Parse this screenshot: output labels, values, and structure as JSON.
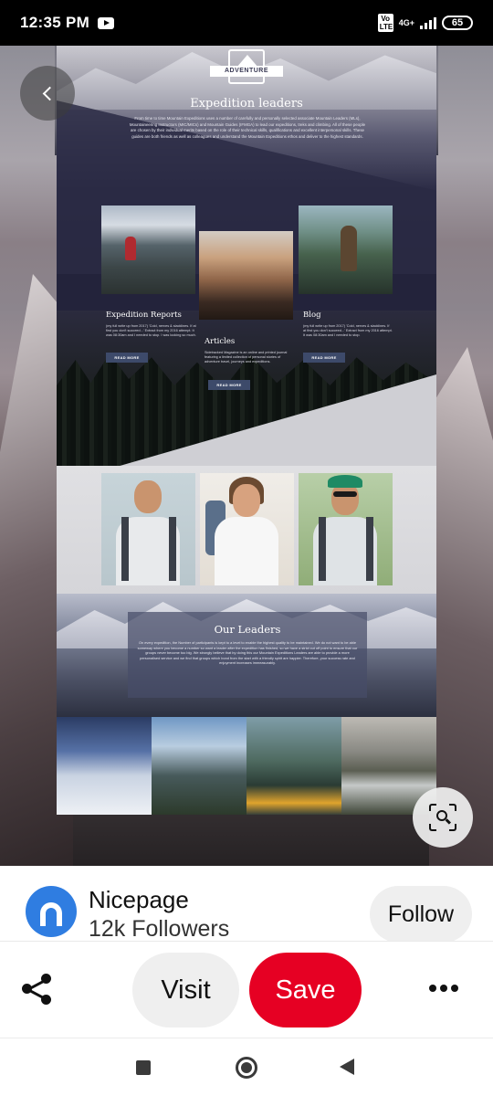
{
  "status_bar": {
    "time": "12:35 PM",
    "volte": "Vo LTE",
    "network": "4G+",
    "battery": "65"
  },
  "pin": {
    "page": {
      "logo_text": "ADVENTURE",
      "hero_title": "Expedition leaders",
      "hero_text": "From time to time Mountain Expeditions uses a number of carefully and personally selected associate Mountain Leaders (MLs), Mountaineering Instructors (MIC/MICs) and Mountain Guides (IFMGA) to lead our expeditions, treks and climbing. All of these people are chosen by their individual merits based on the role of their technical skills, qualifications and excellent interpersonal skills. These guides are both friends as well as colleagues and understand the Mountain Expeditions ethos and deliver to the highest standards.",
      "cards": [
        {
          "title": "Expedition Reports",
          "text": "(my full write up from 2017) 'Cold, nerves & slacklines. If at first you don't succeed...' Extract from my 2016 attempt. It was 08:30am and I needed to stop. I was looking so much.",
          "button": "READ MORE"
        },
        {
          "title": "Articles",
          "text": "Sidetracked Magazine is an online and printed journal featuring a limited collection of personal stories of adventure travel, journeys and expeditions.",
          "button": "READ MORE"
        },
        {
          "title": "Blog",
          "text": "(my full write up from 2017) 'Cold, nerves & slacklines. If at first you don't succeed...' Extract from my 2016 attempt. It was 08:30am and I needed to stop.",
          "button": "READ MORE"
        }
      ],
      "leaders_title": "Our Leaders",
      "leaders_text": "On every expedition, the Number of participants is kept to a level to enable the highest quality to be maintained. We do not want to be able someway where you become a number so want a leader after the expedition has finished, so we have a strict cut off point to ensure that our groups never become too big. We strongly believe that by doing this our Mountain Expeditions Leaders are able to provide a more personalised service and we find that groups which bond from the start with a friendly spirit are happier. Therefore, your success rate and enjoyment increases immeasurably."
    }
  },
  "creator": {
    "name": "Nicepage",
    "followers": "12k Followers",
    "follow_label": "Follow"
  },
  "actions": {
    "visit_label": "Visit",
    "save_label": "Save"
  },
  "colors": {
    "save": "#e60023",
    "avatar": "#2f7de1",
    "page_dark": "#23233b"
  }
}
